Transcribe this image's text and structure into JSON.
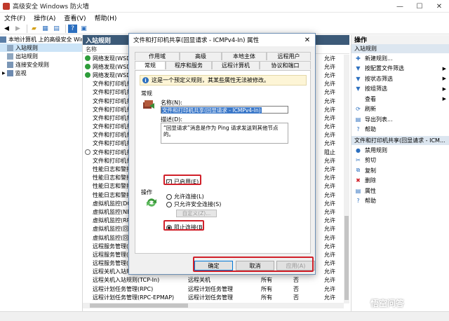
{
  "window": {
    "title": "高级安全 Windows 防火墙",
    "controls": [
      "—",
      "☐",
      "✕"
    ]
  },
  "menu": [
    "文件(F)",
    "操作(A)",
    "查看(V)",
    "帮助(H)"
  ],
  "tree": {
    "items": [
      {
        "label": "本地计算机 上的高级安全 Win"
      },
      {
        "label": "入站规则"
      },
      {
        "label": "出站规则"
      },
      {
        "label": "连接安全规则"
      },
      {
        "label": "监视"
      }
    ]
  },
  "center": {
    "header": "入站规则",
    "col_name": "名称",
    "rows": [
      {
        "icon": "green",
        "name": "网络发现(WSD",
        "c5": "允许"
      },
      {
        "icon": "green",
        "name": "网络发现(WSD",
        "c5": "允许"
      },
      {
        "icon": "green",
        "name": "网络发现(WSD",
        "c5": "允许"
      },
      {
        "icon": "none",
        "name": "文件和打印机共",
        "c5": "允许"
      },
      {
        "icon": "none",
        "name": "文件和打印机共",
        "c5": "允许"
      },
      {
        "icon": "none",
        "name": "文件和打印机共",
        "c5": "允许"
      },
      {
        "icon": "none",
        "name": "文件和打印机共",
        "c5": "允许"
      },
      {
        "icon": "none",
        "name": "文件和打印机共",
        "c5": "允许"
      },
      {
        "icon": "none",
        "name": "文件和打印机共",
        "c5": "允许"
      },
      {
        "icon": "none",
        "name": "文件和打印机共",
        "c5": "允许"
      },
      {
        "icon": "none",
        "name": "文件和打印机共",
        "c5": "允许"
      },
      {
        "icon": "block",
        "name": "文件和打印机共",
        "c5": "阻止"
      },
      {
        "icon": "none",
        "name": "文件和打印机共",
        "c5": "允许"
      },
      {
        "icon": "none",
        "name": "性能日志和警报",
        "c5": "允许"
      },
      {
        "icon": "none",
        "name": "性能日志和警报",
        "c5": "允许"
      },
      {
        "icon": "none",
        "name": "性能日志和警报",
        "c5": "允许"
      },
      {
        "icon": "none",
        "name": "性能日志和警报",
        "c5": "允许"
      },
      {
        "icon": "none",
        "name": "虚拟机监控(DC",
        "c5": "允许"
      },
      {
        "icon": "none",
        "name": "虚拟机监控(NB",
        "c5": "允许"
      },
      {
        "icon": "none",
        "name": "虚拟机监控(RP",
        "c5": "允许"
      },
      {
        "icon": "none",
        "name": "虚拟机监控(回",
        "c5": "允许"
      },
      {
        "icon": "none",
        "name": "虚拟机监控(回",
        "c5": "允许"
      },
      {
        "icon": "none",
        "name": "远程服务管理(N",
        "c5": "允许"
      },
      {
        "icon": "none",
        "name": "远程服务管理(R",
        "c5": "允许"
      },
      {
        "icon": "none",
        "name": "远程服务管理(R",
        "c5": "允许"
      },
      {
        "icon": "none",
        "name": "远程关机入站规则(RPC-EP-In)",
        "c2": "远程关机",
        "c3": "所有",
        "c4": "否",
        "c5": "允许"
      },
      {
        "icon": "none",
        "name": "远程关机入站规则(TCP-In)",
        "c2": "远程关机",
        "c3": "所有",
        "c4": "否",
        "c5": "允许"
      },
      {
        "icon": "none",
        "name": "远程计划任务管理(RPC)",
        "c2": "远程计划任务管理",
        "c3": "所有",
        "c4": "否",
        "c5": "允许"
      },
      {
        "icon": "none",
        "name": "远程计划任务管理(RPC-EPMAP)",
        "c2": "远程计划任务管理",
        "c3": "所有",
        "c4": "否",
        "c5": "允许"
      }
    ]
  },
  "actions": {
    "header": "操作",
    "section1": "入站规则",
    "items1": [
      {
        "icon": "✚",
        "label": "新建规则...",
        "arrow": ""
      },
      {
        "icon": "▼",
        "label": "按配置文件筛选",
        "arrow": "▶"
      },
      {
        "icon": "▼",
        "label": "按状态筛选",
        "arrow": "▶"
      },
      {
        "icon": "▼",
        "label": "按组筛选",
        "arrow": "▶"
      },
      {
        "icon": "",
        "label": "查看",
        "arrow": "▶"
      },
      {
        "icon": "⟳",
        "label": "刷新",
        "arrow": ""
      },
      {
        "icon": "▤",
        "label": "导出列表...",
        "arrow": ""
      },
      {
        "icon": "?",
        "label": "帮助",
        "arrow": ""
      }
    ],
    "section2": "文件和打印机共享(回显请求 - ICM...",
    "items2": [
      {
        "icon": "●",
        "label": "禁用规则"
      },
      {
        "icon": "✂",
        "label": "剪切"
      },
      {
        "icon": "⧉",
        "label": "复制"
      },
      {
        "icon": "✖",
        "label": "删除"
      },
      {
        "icon": "▤",
        "label": "属性"
      },
      {
        "icon": "?",
        "label": "帮助"
      }
    ]
  },
  "dialog": {
    "title": "文件和打印机共享(回显请求 - ICMPv4-In) 属性",
    "close": "✕",
    "tabs_top": [
      "作用域",
      "高级",
      "本地主体",
      "远程用户"
    ],
    "tabs_bottom": [
      "常规",
      "程序和服务",
      "远程计算机",
      "协议和端口"
    ],
    "info": "这是一个预定义规则，其某些属性无法被修改。",
    "general_label": "常规",
    "name_label": "名称(N):",
    "name_value": "文件和打印机共享(回显请求 - ICMPv4-In)",
    "desc_label": "描述(D):",
    "desc_value": "“回显请求”消息是作为 Ping 请求发送到其他节点的。",
    "enabled_label": "已启用(E)",
    "enabled_check": "✓",
    "action_label": "操作",
    "opt_allow": "允许连接(L)",
    "opt_secure": "只允许安全连接(S)",
    "custom_btn": "自定义(Z)...",
    "opt_block": "阻止连接(B)",
    "ok": "确定",
    "cancel": "取消",
    "apply": "应用(A)"
  },
  "watermark": "悟空问答"
}
